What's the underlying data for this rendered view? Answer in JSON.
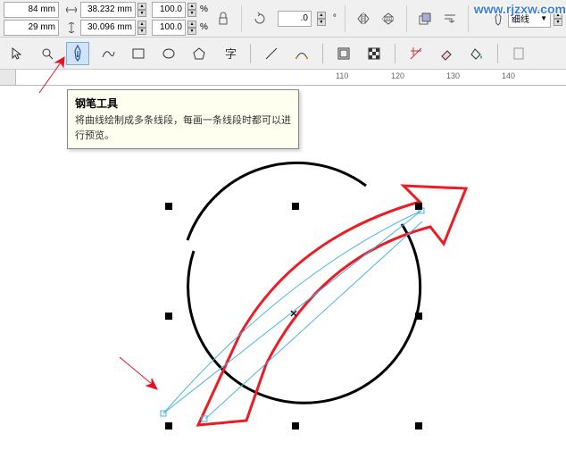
{
  "dimensions": {
    "x_label": "84 mm",
    "y_label": "29 mm",
    "width": "38.232 mm",
    "height": "30.096 mm",
    "scale_x": "100.0",
    "scale_y": "100.0",
    "pct_unit": "%",
    "angle": ".0",
    "deg": "°"
  },
  "outline": {
    "label": "细线"
  },
  "tooltip": {
    "title": "钢笔工具",
    "desc": "将曲线绘制成多条线段，每画一条线段时都可以进行预览。"
  },
  "ruler": {
    "ticks": [
      "110",
      "120",
      "130",
      "140"
    ]
  },
  "watermark": "www.rjzxw.com"
}
